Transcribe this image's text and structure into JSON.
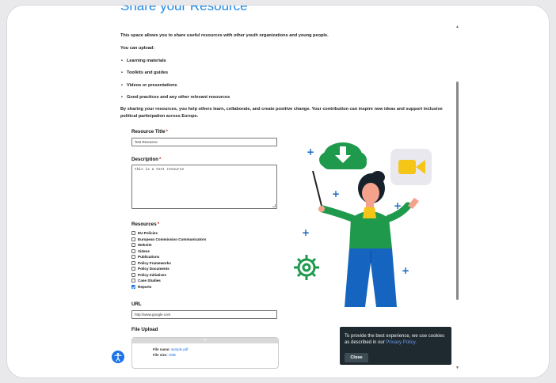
{
  "page": {
    "heading": "Share your Resource",
    "intro": "This space allows you to share useful resources with other youth organizations and young people.",
    "upload_intro": "You can upload:",
    "bullets": [
      "Learning materials",
      "Toolkits and guides",
      "Videos or presentations",
      "Good practices and any other relevant resources"
    ],
    "closing": "By sharing your resources, you help others learn, collaborate, and create positive change. Your contribution can inspire new ideas and support inclusive political participation across Europe."
  },
  "form": {
    "title_label": "Resource Title",
    "title_value": "Test Resource",
    "description_label": "Description",
    "description_value": "this is a test resource",
    "resources_label": "Resources",
    "required_mark": "*",
    "resources": [
      {
        "label": "EU Policies",
        "checked": false
      },
      {
        "label": "European Commission Communicators",
        "checked": false
      },
      {
        "label": "Website",
        "checked": false
      },
      {
        "label": "Videos",
        "checked": false
      },
      {
        "label": "Publications",
        "checked": false
      },
      {
        "label": "Policy Frameworks",
        "checked": false
      },
      {
        "label": "Policy Documents",
        "checked": false
      },
      {
        "label": "Policy Initiatives",
        "checked": false
      },
      {
        "label": "Case Studies",
        "checked": false
      },
      {
        "label": "Reports",
        "checked": true
      }
    ],
    "url_label": "URL",
    "url_value": "http://www.google.com",
    "file_upload_label": "File Upload",
    "upload_bar_text": "≡",
    "file_name_label": "File name:",
    "file_name": "sample.pdf",
    "file_size_label": "File size:",
    "file_size": "1MB"
  },
  "cookie": {
    "text": "To provide the best experience, we use cookies as described in our",
    "link": "Privacy Policy.",
    "close_label": "Close"
  },
  "colors": {
    "accent": "#1e88e5",
    "illustration_green": "#1f9a4c",
    "illustration_blue": "#1565c0",
    "camera_yellow": "#f5c518",
    "cookie_bg": "#1f2a30"
  },
  "icons": {
    "accessibility": "accessibility-icon",
    "scroll_up": "scroll-up-icon",
    "scroll_down": "scroll-down-icon"
  }
}
